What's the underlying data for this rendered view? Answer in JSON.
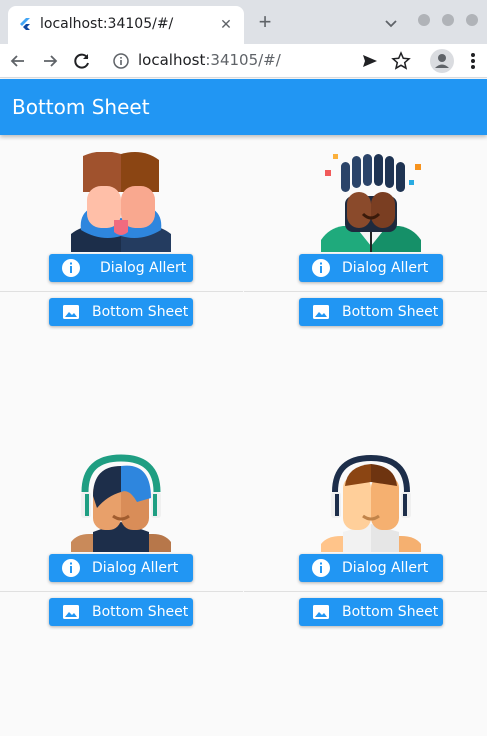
{
  "browser": {
    "tab_title": "localhost:34105/#/",
    "url_host": "localhost",
    "url_rest": ":34105/#/",
    "icons": [
      "flutter-icon",
      "close-icon",
      "plus-icon",
      "chevron-down-icon",
      "back-icon",
      "forward-icon",
      "reload-icon",
      "info-icon",
      "send-icon",
      "star-icon",
      "profile-icon",
      "more-icon"
    ]
  },
  "appbar": {
    "title": "Bottom Sheet"
  },
  "cards": [
    {
      "dialog_label": "Dialog Allert",
      "sheet_label": "Bottom Sheet"
    },
    {
      "dialog_label": "Dialog Allert",
      "sheet_label": "Bottom Sheet"
    },
    {
      "dialog_label": "Dialog Allert",
      "sheet_label": "Bottom Sheet"
    },
    {
      "dialog_label": "Dialog Allert",
      "sheet_label": "Bottom Sheet"
    }
  ],
  "colors": {
    "primary": "#2196f3",
    "tab_bar": "#dee1e6"
  }
}
